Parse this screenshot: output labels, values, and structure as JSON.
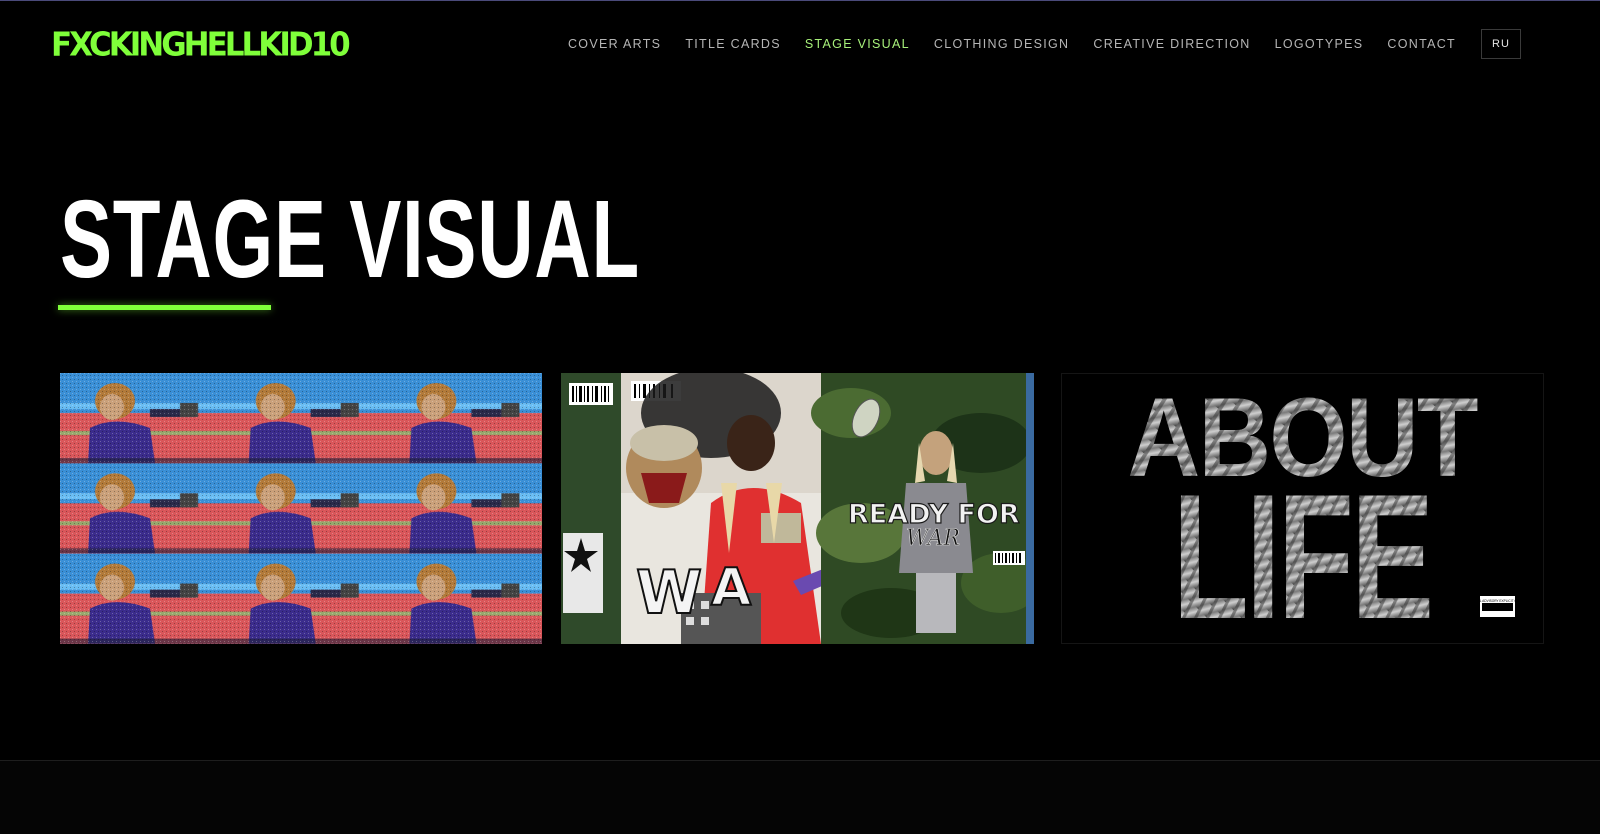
{
  "site": {
    "logo": "FXCKINGHELLKID10"
  },
  "nav": {
    "items": [
      {
        "label": "COVER ARTS"
      },
      {
        "label": "TITLE CARDS"
      },
      {
        "label": "STAGE VISUAL"
      },
      {
        "label": "CLOTHING DESIGN"
      },
      {
        "label": "CREATIVE DIRECTION"
      },
      {
        "label": "LOGOTYPES"
      },
      {
        "label": "CONTACT"
      }
    ],
    "active": "STAGE VISUAL",
    "language": "RU"
  },
  "page": {
    "title": "STAGE VISUAL"
  },
  "gallery": {
    "items": [
      {
        "texts": []
      },
      {
        "texts": [
          "READY FOR",
          "WAR"
        ]
      },
      {
        "texts": [
          "ABOUT",
          "LIFE",
          "PARENTAL ADVISORY EXPLICIT CONTENT"
        ]
      }
    ]
  },
  "colors": {
    "accent": "#7fff3a",
    "background": "#000000",
    "nav_text": "#b5b5b5",
    "nav_active": "#a7f07a"
  }
}
